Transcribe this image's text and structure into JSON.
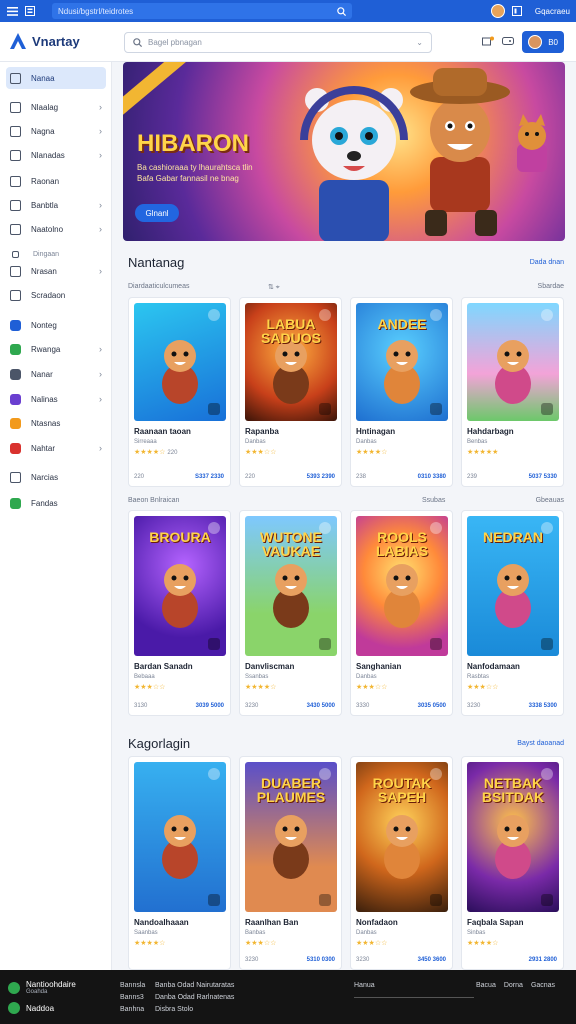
{
  "topbar": {
    "url": "Ndusi/bgstrl/teidrotes",
    "right_label": "Gqacraeu"
  },
  "header": {
    "logo": "Vnartay",
    "search_placeholder": "Bagel pbnagan",
    "user_label": "B0"
  },
  "sidebar": {
    "items": [
      {
        "label": "Nanaa",
        "active": true,
        "arrow": false
      },
      {
        "label": "Nlaalag",
        "arrow": true
      },
      {
        "label": "Nagna",
        "arrow": true
      },
      {
        "label": "Nlanadas",
        "arrow": true
      },
      {
        "label": "Raonan",
        "arrow": false
      },
      {
        "label": "Banbtla",
        "arrow": true
      },
      {
        "label": "Naatolno",
        "arrow": true
      },
      {
        "label": "Dingaan",
        "arrow": false,
        "sub": true
      },
      {
        "label": "Nrasan",
        "arrow": true
      },
      {
        "label": "Scradaon",
        "arrow": false
      },
      {
        "label": "Nonteg",
        "arrow": false,
        "color": "#1f5fd6"
      },
      {
        "label": "Rwanga",
        "arrow": true,
        "color": "#2fa84f"
      },
      {
        "label": "Nanar",
        "arrow": true,
        "color": "#4b5568"
      },
      {
        "label": "Nalinas",
        "arrow": true,
        "color": "#6a3fd0"
      },
      {
        "label": "Ntasnas",
        "arrow": false,
        "color": "#f29a1c"
      },
      {
        "label": "Nahtar",
        "arrow": true,
        "color": "#d9322e"
      },
      {
        "label": "Narcias",
        "arrow": false
      },
      {
        "label": "Fandas",
        "arrow": false,
        "color": "#2fa84f"
      }
    ]
  },
  "banner": {
    "title": "HIBARON",
    "subtitle": "Ba cashioraaa ty lhaurahtsca tlin Bafa Gabar fannasil ne bnag",
    "button": "Glnanl"
  },
  "sections": [
    {
      "title": "Nantanag",
      "link": "Dada dnan",
      "rows": [
        {
          "left": "Diardaaticulcumeas",
          "right": "Sbardae"
        },
        {
          "left": "Baeon Bnlraican",
          "right": "Gbeauas"
        }
      ]
    },
    {
      "title": "Kagorlagin",
      "link": "Bayst daoanad"
    }
  ],
  "cards": [
    {
      "name": "Raanaan taoan",
      "dev": "Sirreaaa",
      "stars": "★★★★☆",
      "reviews": "220",
      "size": "220",
      "price": "S337 2330"
    },
    {
      "name": "Rapanba",
      "dev": "Danbas",
      "stars": "★★★☆☆",
      "reviews": "",
      "size": "220",
      "price": "5393 2390"
    },
    {
      "name": "Hntinagan",
      "dev": "Danbas",
      "stars": "★★★★☆",
      "reviews": "",
      "size": "238",
      "price": "0310 3380"
    },
    {
      "name": "Hahdarbagn",
      "dev": "Benbas",
      "stars": "★★★★★",
      "reviews": "",
      "size": "239",
      "price": "5037 5330"
    },
    {
      "name": "Bardan Sanadn",
      "dev": "Bebaaa",
      "stars": "★★★☆☆",
      "reviews": "",
      "size": "3130",
      "price": "3039 5000"
    },
    {
      "name": "Danvliscman",
      "dev": "Ssanbas",
      "stars": "★★★★☆",
      "reviews": "",
      "size": "3230",
      "price": "3430 5000"
    },
    {
      "name": "Sanghanian",
      "dev": "Danbas",
      "stars": "★★★☆☆",
      "reviews": "",
      "size": "3330",
      "price": "3035 0500"
    },
    {
      "name": "Nanfodamaan",
      "dev": "Rasbtas",
      "stars": "★★★☆☆",
      "reviews": "",
      "size": "3230",
      "price": "3338 5300"
    },
    {
      "name": "Nandoalhaaan",
      "dev": "Saanbas",
      "stars": "★★★★☆",
      "reviews": "",
      "size": "",
      "price": ""
    },
    {
      "name": "Raanlhan Ban",
      "dev": "Banbas",
      "stars": "★★★☆☆",
      "reviews": "",
      "size": "3230",
      "price": "5310 0300"
    },
    {
      "name": "Nonfadaon",
      "dev": "Danbas",
      "stars": "★★★☆☆",
      "reviews": "",
      "size": "3230",
      "price": "3450 3600"
    },
    {
      "name": "Faqbala Sapan",
      "dev": "Sinbas",
      "stars": "★★★★☆",
      "reviews": "",
      "size": "",
      "price": "2931 2800"
    }
  ],
  "card_art": [
    {
      "bg": "linear-gradient(160deg,#2cc6f0,#1870d8)",
      "text": ""
    },
    {
      "bg": "radial-gradient(circle at 50% 40%,#ffb040,#c8401a 60%,#3a1408)",
      "text": "LABUA SADUOS"
    },
    {
      "bg": "radial-gradient(circle at 50% 40%,#5ad0ff,#1e6fd0)",
      "text": "ANDEE"
    },
    {
      "bg": "linear-gradient(180deg,#7fd7ff,#f3a3d8 60%,#6cc86a)",
      "text": ""
    },
    {
      "bg": "radial-gradient(circle at 55% 35%,#b463ff,#4a1aa8 70%)",
      "text": "BROURA"
    },
    {
      "bg": "linear-gradient(180deg,#7ec8ff,#8ad46a 70%)",
      "text": "WUTONE VAUKAE"
    },
    {
      "bg": "radial-gradient(circle at 50% 40%,#ffe070,#ff8a3a 40%,#c03a9a 80%)",
      "text": "ROOLS LABIAS"
    },
    {
      "bg": "linear-gradient(180deg,#39b6f5,#1a8ad8)",
      "text": "NEDRAN"
    },
    {
      "bg": "linear-gradient(180deg,#37b0f0,#2270d0)",
      "text": ""
    },
    {
      "bg": "linear-gradient(180deg,#5a4fc9,#e08a50 70%)",
      "text": "DUABER PLAUMES"
    },
    {
      "bg": "radial-gradient(circle at 50% 40%,#ffd25a,#d0671c 50%,#3a1f0c)",
      "text": "ROUTAK SAPEH"
    },
    {
      "bg": "radial-gradient(circle at 50% 40%,#ffc24a,#7a2aa8 60%,#2a0e5a)",
      "text": "NETBAK BSITDAK"
    }
  ],
  "footer": {
    "brand": "Nantioohdaire",
    "brand_sub": "Goahda",
    "brand2": "Naddoa",
    "col1": [
      "Bannsla",
      "Banns3",
      "Banhna"
    ],
    "col2": [
      "Banba Odad Nairutaratas",
      "Danba Odad Rarlnatenas",
      "Disbra Stolo"
    ],
    "col3_title": "Hanua",
    "col4": [
      "Bacua",
      "Dorna",
      "Gacnas"
    ]
  },
  "colors": {
    "accent": "#1f5fd6",
    "star": "#f2b632",
    "footer_bg": "#141414"
  }
}
